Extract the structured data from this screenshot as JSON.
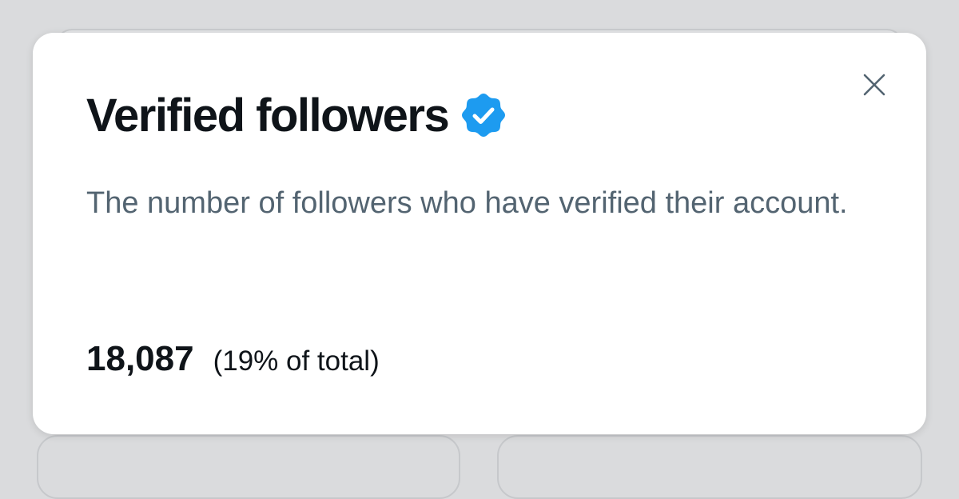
{
  "modal": {
    "title": "Verified followers",
    "badge_icon": "verified-badge-icon",
    "badge_color": "#1d9bf0",
    "close_icon": "close-icon",
    "description": "The number of followers who have verified their account.",
    "count": "18,087",
    "percent_text": "(19% of total)"
  }
}
